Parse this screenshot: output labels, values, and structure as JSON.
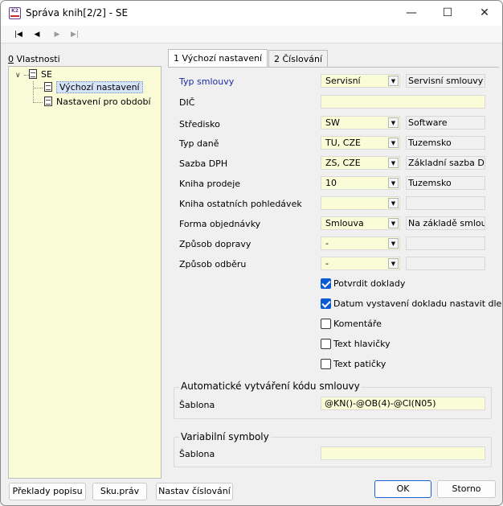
{
  "window": {
    "title": "Správa knih[2/2] - SE",
    "app_icon": "K2-icon",
    "app_icon_text": "K2",
    "controls": {
      "minimize": "—",
      "maximize": "☐",
      "close": "✕"
    }
  },
  "toolbar": {
    "first": "|◀",
    "prev": "◀",
    "next": "▶",
    "last": "▶|"
  },
  "left": {
    "props_underline": "0",
    "props_label": " Vlastnosti",
    "tree": {
      "root_expander": "∨",
      "root": "SE",
      "items": [
        "Výchozí nastavení",
        "Nastavení pro období"
      ]
    }
  },
  "tabs": [
    "1 Výchozí nastavení",
    "2 Číslování"
  ],
  "form": {
    "typ_smlouvy": {
      "label": "Typ smlouvy",
      "value": "Servisní",
      "desc": "Servisní smlouvy"
    },
    "dic": {
      "label": "DIČ",
      "value": ""
    },
    "stredisko": {
      "label": "Středisko",
      "value": "SW",
      "desc": "Software"
    },
    "typ_dane": {
      "label": "Typ daně",
      "value": "TU, CZE",
      "desc": "Tuzemsko"
    },
    "sazba_dph": {
      "label": "Sazba DPH",
      "value": "ZS, CZE",
      "desc": "Základní sazba DPH"
    },
    "kniha_prodeje": {
      "label": "Kniha prodeje",
      "value": "10",
      "desc": "Tuzemsko"
    },
    "kniha_ostatnich": {
      "label": "Kniha ostatních pohledávek",
      "value": "",
      "desc": ""
    },
    "forma_objednavky": {
      "label": "Forma objednávky",
      "value": "Smlouva",
      "desc": "Na základě smlouvy"
    },
    "zpusob_dopravy": {
      "label": "Způsob dopravy",
      "value": "-",
      "desc": ""
    },
    "zpusob_odberu": {
      "label": "Způsob odběru",
      "value": "-",
      "desc": ""
    },
    "dropdown_glyph": "▼"
  },
  "checkboxes": [
    {
      "label": "Potvrdit doklady",
      "checked": true
    },
    {
      "label": "Datum vystavení dokladu nastavit dle d",
      "checked": true
    },
    {
      "label": "Komentáře",
      "checked": false
    },
    {
      "label": "Text hlavičky",
      "checked": false
    },
    {
      "label": "Text patičky",
      "checked": false
    }
  ],
  "auto_code": {
    "title": "Automatické vytváření kódu smlouvy",
    "sablona_label": "Šablona",
    "sablona_value": "@KN()-@OB(4)-@CI(N05)"
  },
  "variabilni": {
    "title": "Variabilní symboly",
    "sablona_label": "Šablona",
    "sablona_value": ""
  },
  "buttons": {
    "preklady": "Překlady popisu",
    "sku": "Sku.práv",
    "nastav": "Nastav číslování",
    "ok": "OK",
    "storno": "Storno"
  }
}
